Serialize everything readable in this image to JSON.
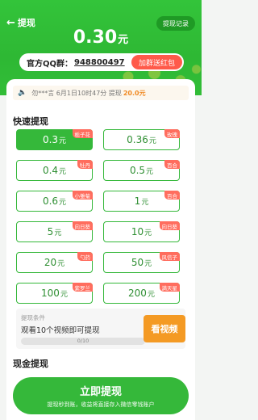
{
  "header": {
    "back_label": "提现",
    "record_label": "提现记录",
    "balance_amount": "0.30",
    "balance_unit": "元"
  },
  "qq_bar": {
    "label": "官方QQ群：",
    "number": "948800497",
    "button_label": "加群送红包"
  },
  "notice": {
    "user": "勿***言",
    "text": "6月1日10时47分 提现",
    "highlight": "20.0元"
  },
  "quick_withdraw": {
    "title": "快速提现",
    "unit": "元",
    "options": [
      {
        "amount": "0.3",
        "tag": "栀子花",
        "selected": true
      },
      {
        "amount": "0.36",
        "tag": "玫瑰",
        "selected": false
      },
      {
        "amount": "0.4",
        "tag": "牡丹",
        "selected": false
      },
      {
        "amount": "0.5",
        "tag": "百合",
        "selected": false
      },
      {
        "amount": "0.6",
        "tag": "小雏菊",
        "selected": false
      },
      {
        "amount": "1",
        "tag": "百合",
        "selected": false
      },
      {
        "amount": "5",
        "tag": "向日葵",
        "selected": false
      },
      {
        "amount": "10",
        "tag": "向日葵",
        "selected": false
      },
      {
        "amount": "20",
        "tag": "勺药",
        "selected": false
      },
      {
        "amount": "50",
        "tag": "风信子",
        "selected": false
      },
      {
        "amount": "100",
        "tag": "紫罗兰",
        "selected": false
      },
      {
        "amount": "200",
        "tag": "满天星",
        "selected": false
      }
    ]
  },
  "condition": {
    "label": "提现条件",
    "text": "观看10个视频即可提现",
    "progress_text": "0/10",
    "progress_fraction": 0.0,
    "button_label": "看视频"
  },
  "cash_withdraw": {
    "title": "现金提现"
  },
  "bottom_button": {
    "label": "立即提现",
    "sub_label": "提现秒到账，收益将直接存入微信零钱账户"
  },
  "colors": {
    "brand_green": "#35b83a",
    "accent_red": "#ff5a4a",
    "accent_orange": "#f49a24"
  }
}
